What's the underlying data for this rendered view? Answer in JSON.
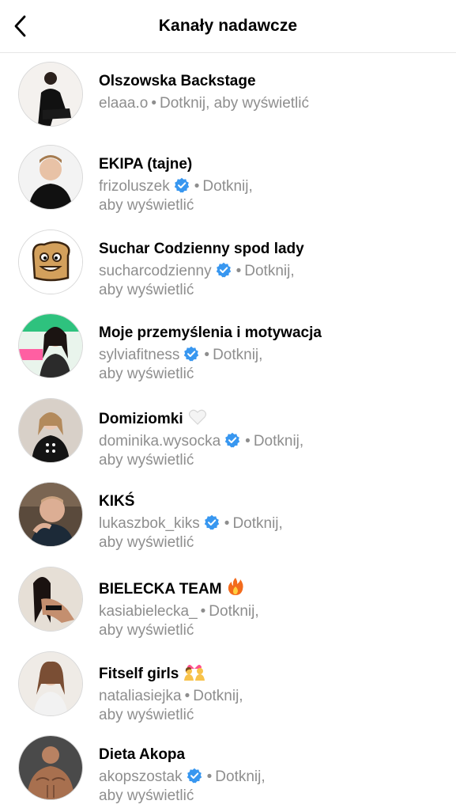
{
  "header": {
    "title": "Kanały nadawcze",
    "back_icon": "chevron-left-icon"
  },
  "colors": {
    "verified": "#3897f0",
    "secondary_text": "#8e8e8e"
  },
  "channels": [
    {
      "name": "Olszowska Backstage",
      "username": "elaaa.o",
      "verified": false,
      "action": "Dotknij, aby wyświetlić",
      "action_part1": "",
      "action_part2": ""
    },
    {
      "name": "EKIPA (tajne)",
      "username": "frizoluszek",
      "verified": true,
      "action_part1": "Dotknij,",
      "action_part2": "aby wyświetlić"
    },
    {
      "name": "Suchar Codzienny spod lady",
      "username": "sucharcodzienny",
      "verified": true,
      "action_part1": "Dotknij,",
      "action_part2": "aby wyświetlić"
    },
    {
      "name": "Moje przemyślenia i motywacja",
      "username": "sylviafitness",
      "verified": true,
      "action_part1": "Dotknij,",
      "action_part2": "aby wyświetlić"
    },
    {
      "name": "Domiziomki",
      "emoji": "white-heart-icon",
      "username": "dominika.wysocka",
      "verified": true,
      "action_part1": "Dotknij,",
      "action_part2": "aby wyświetlić"
    },
    {
      "name": "KIKŚ",
      "username": "lukaszbok_kiks",
      "verified": true,
      "action_part1": "Dotknij,",
      "action_part2": "aby wyświetlić"
    },
    {
      "name": "BIELECKA TEAM",
      "emoji": "fire-icon",
      "username": "kasiabielecka_",
      "verified": false,
      "action_part1": "Dotknij,",
      "action_part2": "aby wyświetlić"
    },
    {
      "name": "Fitself girls",
      "emoji": "couple-heart-icon",
      "username": "nataliasiejka",
      "verified": false,
      "action_part1": "Dotknij,",
      "action_part2": "aby wyświetlić"
    },
    {
      "name": "Dieta Akopa",
      "username": "akopszostak",
      "verified": true,
      "action_part1": "Dotknij,",
      "action_part2": "aby wyświetlić"
    }
  ],
  "separator": "•"
}
